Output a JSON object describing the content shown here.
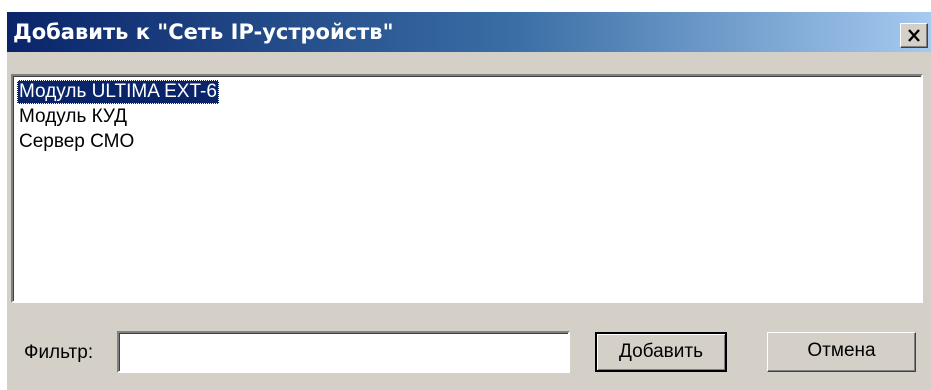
{
  "window": {
    "title": "Добавить к \"Сеть IP-устройств\"",
    "close_icon": "close-icon"
  },
  "list": {
    "items": [
      {
        "label": "Модуль ULTIMA EXT-6",
        "selected": true
      },
      {
        "label": "Модуль КУД",
        "selected": false
      },
      {
        "label": "Сервер СМО",
        "selected": false
      }
    ]
  },
  "filter": {
    "label": "Фильтр:",
    "value": "",
    "placeholder": ""
  },
  "buttons": {
    "add_label": "Добавить",
    "cancel_label": "Отмена"
  },
  "colors": {
    "title_gradient_start": "#0a246a",
    "title_gradient_end": "#a6caf0",
    "dialog_bg": "#d4d0c8",
    "selection_bg": "#0a246a"
  }
}
